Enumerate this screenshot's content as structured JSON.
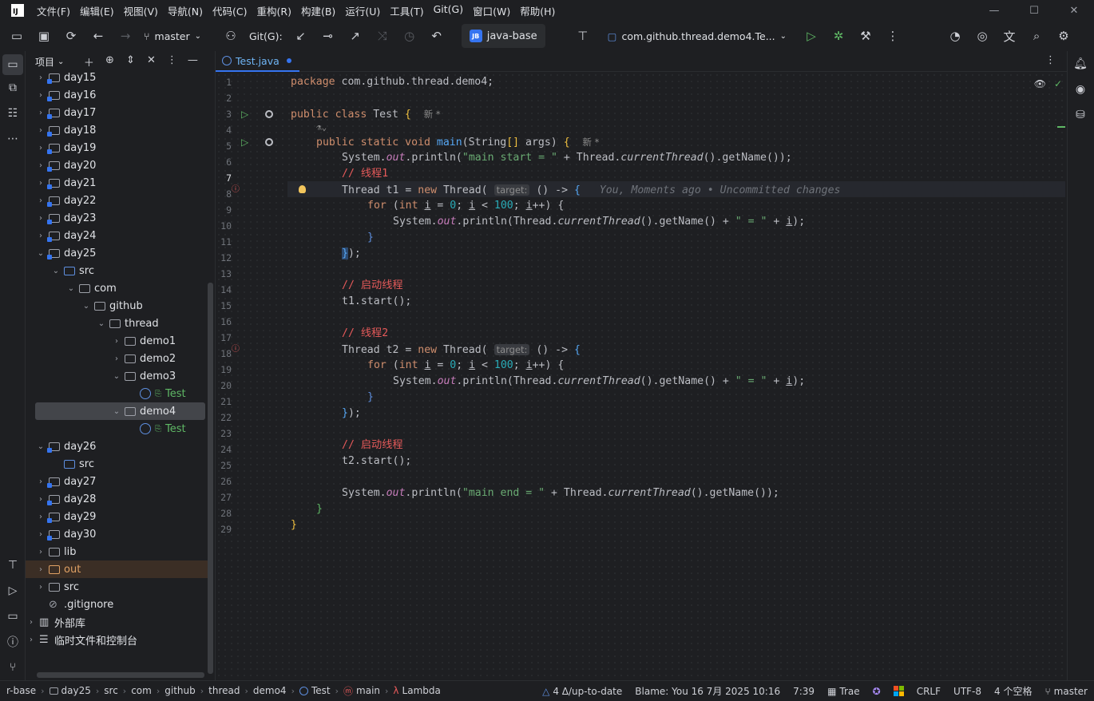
{
  "menu": [
    "文件(F)",
    "编辑(E)",
    "视图(V)",
    "导航(N)",
    "代码(C)",
    "重构(R)",
    "构建(B)",
    "运行(U)",
    "工具(T)",
    "Git(G)",
    "窗口(W)",
    "帮助(H)"
  ],
  "toolbar": {
    "branch": "master",
    "git_label": "Git(G):",
    "project": "java-base",
    "project_badge": "JB",
    "run_config": "com.github.thread.demo4.Te..."
  },
  "panel": {
    "title": "项目"
  },
  "tree": [
    {
      "label": "day15",
      "depth": 0,
      "arrow": "›",
      "icon": "module"
    },
    {
      "label": "day16",
      "depth": 0,
      "arrow": "›",
      "icon": "module"
    },
    {
      "label": "day17",
      "depth": 0,
      "arrow": "›",
      "icon": "module"
    },
    {
      "label": "day18",
      "depth": 0,
      "arrow": "›",
      "icon": "module"
    },
    {
      "label": "day19",
      "depth": 0,
      "arrow": "›",
      "icon": "module"
    },
    {
      "label": "day20",
      "depth": 0,
      "arrow": "›",
      "icon": "module"
    },
    {
      "label": "day21",
      "depth": 0,
      "arrow": "›",
      "icon": "module"
    },
    {
      "label": "day22",
      "depth": 0,
      "arrow": "›",
      "icon": "module"
    },
    {
      "label": "day23",
      "depth": 0,
      "arrow": "›",
      "icon": "module"
    },
    {
      "label": "day24",
      "depth": 0,
      "arrow": "›",
      "icon": "module"
    },
    {
      "label": "day25",
      "depth": 0,
      "arrow": "⌄",
      "icon": "module"
    },
    {
      "label": "src",
      "depth": 1,
      "arrow": "⌄",
      "icon": "src"
    },
    {
      "label": "com",
      "depth": 2,
      "arrow": "⌄",
      "icon": "pkg"
    },
    {
      "label": "github",
      "depth": 3,
      "arrow": "⌄",
      "icon": "pkg"
    },
    {
      "label": "thread",
      "depth": 4,
      "arrow": "⌄",
      "icon": "pkg"
    },
    {
      "label": "demo1",
      "depth": 5,
      "arrow": "›",
      "icon": "pkg"
    },
    {
      "label": "demo2",
      "depth": 5,
      "arrow": "›",
      "icon": "pkg"
    },
    {
      "label": "demo3",
      "depth": 5,
      "arrow": "⌄",
      "icon": "pkg"
    },
    {
      "label": "Test",
      "depth": 6,
      "arrow": "",
      "icon": "java",
      "green": true
    },
    {
      "label": "demo4",
      "depth": 5,
      "arrow": "⌄",
      "icon": "pkg",
      "selected": true
    },
    {
      "label": "Test",
      "depth": 6,
      "arrow": "",
      "icon": "java",
      "green": true
    },
    {
      "label": "day26",
      "depth": 0,
      "arrow": "⌄",
      "icon": "module"
    },
    {
      "label": "src",
      "depth": 1,
      "arrow": "",
      "icon": "src"
    },
    {
      "label": "day27",
      "depth": 0,
      "arrow": "›",
      "icon": "module"
    },
    {
      "label": "day28",
      "depth": 0,
      "arrow": "›",
      "icon": "module"
    },
    {
      "label": "day29",
      "depth": 0,
      "arrow": "›",
      "icon": "module"
    },
    {
      "label": "day30",
      "depth": 0,
      "arrow": "›",
      "icon": "module"
    },
    {
      "label": "lib",
      "depth": 0,
      "arrow": "›",
      "icon": "folder"
    },
    {
      "label": "out",
      "depth": 0,
      "arrow": "›",
      "icon": "out",
      "out": true
    },
    {
      "label": "src",
      "depth": 0,
      "arrow": "›",
      "icon": "folder"
    },
    {
      "label": ".gitignore",
      "depth": 0,
      "arrow": "",
      "icon": "ignore"
    },
    {
      "label": "外部库",
      "depth": -1,
      "arrow": "›",
      "icon": "lib"
    },
    {
      "label": "临时文件和控制台",
      "depth": -1,
      "arrow": "›",
      "icon": "scratch"
    }
  ],
  "tab": {
    "label": "Test.java"
  },
  "code": {
    "l1": "package com.github.thread.demo4;",
    "new_label": "新 *",
    "hint": "target:",
    "blame": "You, Moments ago • Uncommitted changes",
    "c1": "// 线程1",
    "c2": "// 启动线程",
    "c3": "// 线程2",
    "c4": "// 启动线程",
    "s1": "\"main start = \"",
    "s2": "\" = \"",
    "s3": "\"main end = \"",
    "n0": "0",
    "n100": "100"
  },
  "line_numbers": [
    "1",
    "2",
    "3",
    "4",
    "5",
    "6",
    "7",
    "8",
    "9",
    "10",
    "11",
    "12",
    "13",
    "14",
    "15",
    "16",
    "17",
    "18",
    "19",
    "20",
    "21",
    "22",
    "23",
    "24",
    "25",
    "26",
    "27",
    "28",
    "29"
  ],
  "status": {
    "crumbs": [
      "r-base",
      "day25",
      "src",
      "com",
      "github",
      "thread",
      "demo4",
      "Test",
      "main",
      "Lambda"
    ],
    "vcs": "4 Δ/up-to-date",
    "blame": "Blame: You 16 7月 2025 10:16",
    "pos": "7:39",
    "trae": "Trae",
    "eol": "CRLF",
    "enc": "UTF-8",
    "indent": "4 个空格",
    "branch": "master"
  }
}
